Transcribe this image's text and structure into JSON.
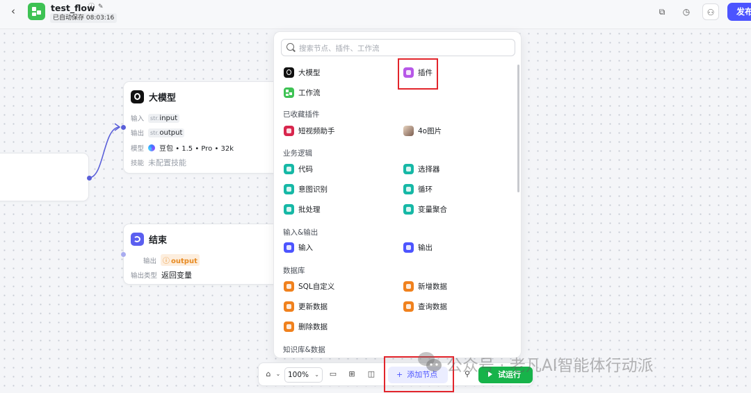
{
  "header": {
    "title": "test_flow",
    "autosave": "已自动保存 08:03:16",
    "publish_label": "发布"
  },
  "nodes": {
    "llm": {
      "title": "大模型",
      "input_label": "输入",
      "input_type": "str.",
      "input_name": "input",
      "output_label": "输出",
      "output_type": "str.",
      "output_name": "output",
      "model_label": "模型",
      "model_value": "豆包 • 1.5 • Pro • 32k",
      "skill_label": "技能",
      "skill_value": "未配置技能"
    },
    "end": {
      "title": "结束",
      "output_label": "输出",
      "output_name": "output",
      "output_type_label": "输出类型",
      "output_type_value": "返回变量"
    }
  },
  "popover": {
    "search_placeholder": "搜索节点、插件、工作流",
    "top_items": [
      "大模型",
      "插件",
      "工作流"
    ],
    "sections": [
      {
        "title": "已收藏插件",
        "items": [
          "短视频助手",
          "4o图片"
        ]
      },
      {
        "title": "业务逻辑",
        "items": [
          "代码",
          "选择器",
          "意图识别",
          "循环",
          "批处理",
          "变量聚合"
        ]
      },
      {
        "title": "输入&输出",
        "items": [
          "输入",
          "输出"
        ]
      },
      {
        "title": "数据库",
        "items": [
          "SQL自定义",
          "新增数据",
          "更新数据",
          "查询数据",
          "删除数据"
        ]
      },
      {
        "title": "知识库&数据",
        "items": []
      }
    ]
  },
  "toolbar": {
    "zoom": "100%",
    "add_node_label": "添加节点",
    "run_label": "试运行"
  },
  "watermark": "公众号 · 老凡AI智能体行动派",
  "colors": {
    "accent": "#4c54ff",
    "run_green": "#17b34a",
    "workflow_green": "#3ec254",
    "plugin_purple": "#b758e8",
    "logic_teal": "#16b8a6",
    "io_blue": "#4c54ff",
    "db_orange": "#f0811d",
    "highlight_red": "#e2242b"
  },
  "icons": {
    "back": "chevron-left-icon",
    "info": "info-icon",
    "edit": "edit-icon",
    "copy": "copy-icon",
    "history": "history-icon",
    "collaborate": "users-icon",
    "mouse": "mouse-icon",
    "comment": "comment-icon",
    "layout": "grid-icon",
    "minimap": "minimap-icon",
    "settings": "wrench-icon"
  }
}
